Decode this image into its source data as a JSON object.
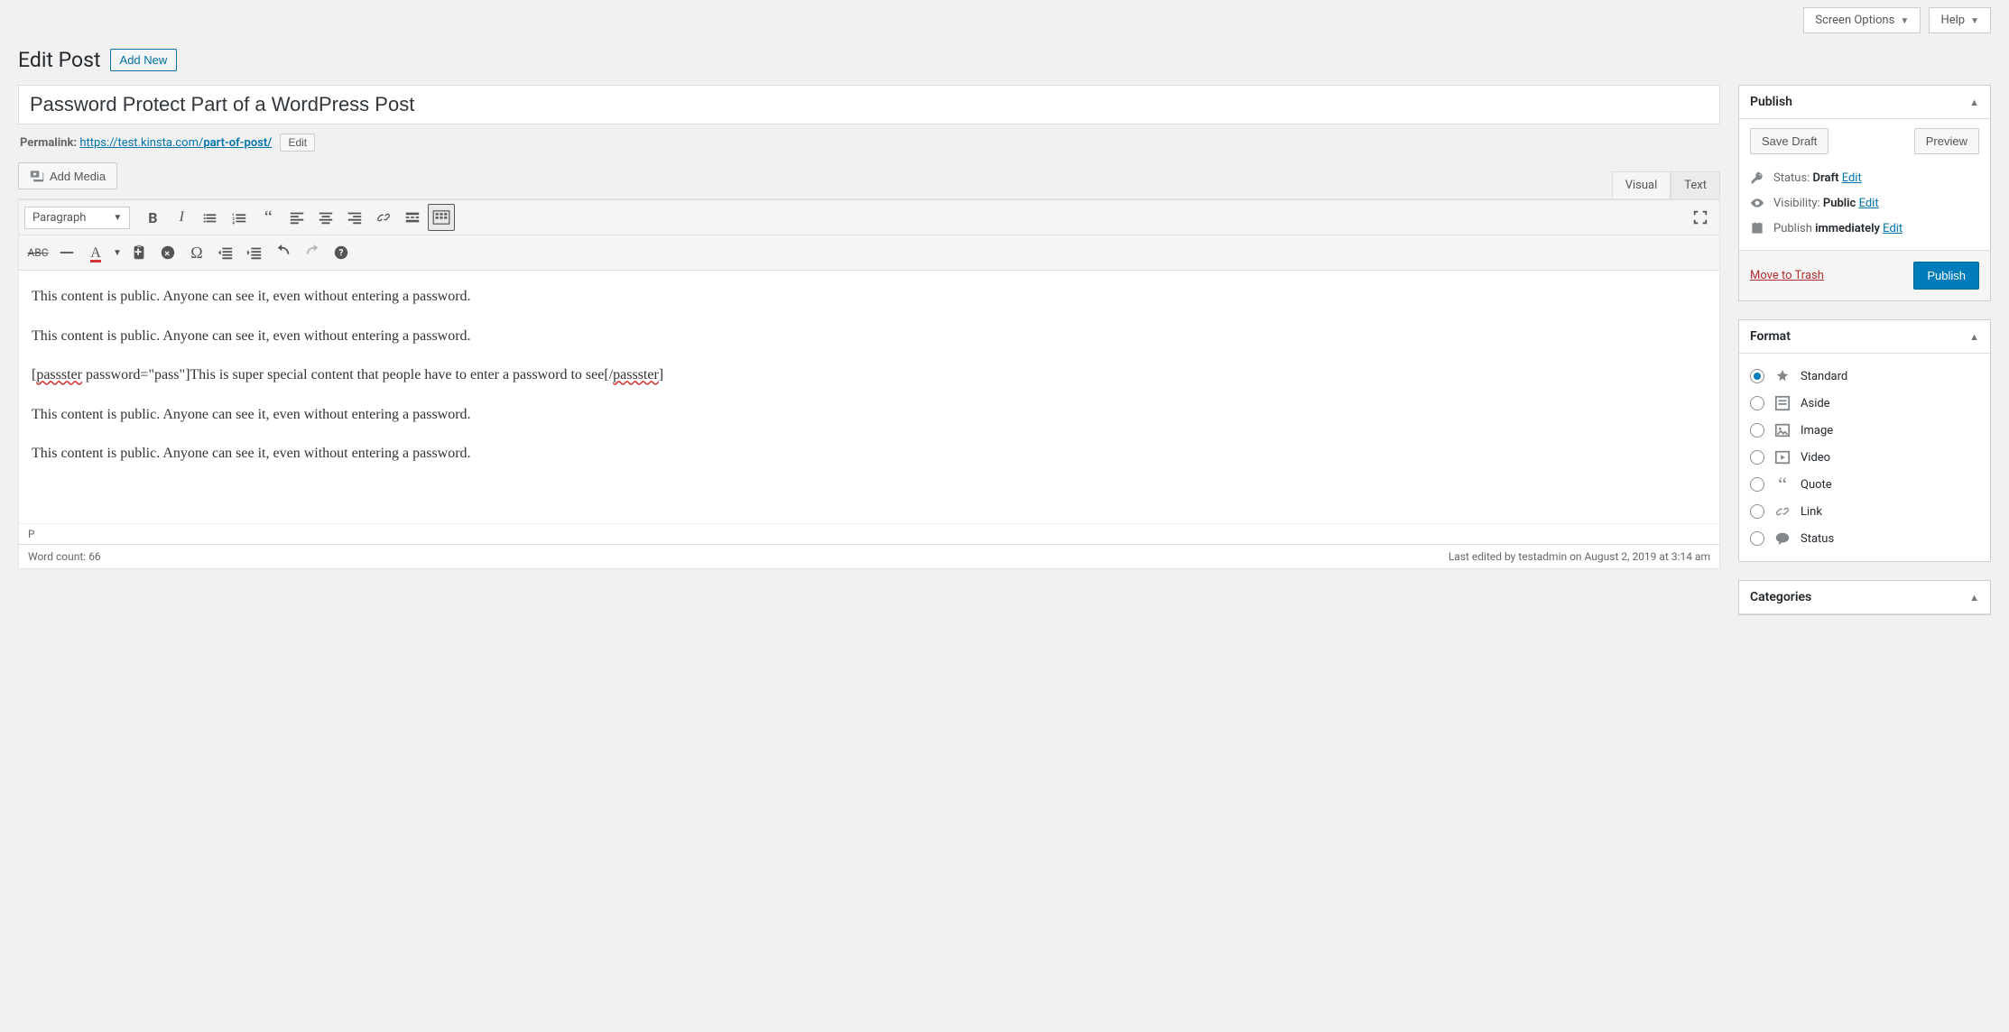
{
  "top": {
    "screen_options": "Screen Options",
    "help": "Help"
  },
  "heading": {
    "title": "Edit Post",
    "add_new": "Add New"
  },
  "post": {
    "title": "Password Protect Part of a WordPress Post",
    "permalink_label": "Permalink:",
    "permalink_base": "https://test.kinsta.com/",
    "permalink_slug": "part-of-post/",
    "edit_btn": "Edit"
  },
  "editor": {
    "add_media": "Add Media",
    "tab_visual": "Visual",
    "tab_text": "Text",
    "format_select": "Paragraph",
    "content": {
      "p1": "This content is public. Anyone can see it, even without entering a password.",
      "p2": "This content is public. Anyone can see it, even without entering a password.",
      "p3_open": "[",
      "p3_tag1": "passster",
      "p3_mid": " password=\"pass\"]This is super special content that people have to enter a password to see[/",
      "p3_tag2": "passster",
      "p3_close": "]",
      "p4": "This content is public. Anyone can see it, even without entering a password.",
      "p5": "This content is public. Anyone can see it, even without entering a password."
    },
    "path": "P",
    "word_count_label": "Word count: ",
    "word_count": "66",
    "last_edited": "Last edited by testadmin on August 2, 2019 at 3:14 am"
  },
  "publish": {
    "title": "Publish",
    "save_draft": "Save Draft",
    "preview": "Preview",
    "status_label": "Status: ",
    "status_value": "Draft",
    "visibility_label": "Visibility: ",
    "visibility_value": "Public",
    "schedule_label": "Publish ",
    "schedule_value": "immediately",
    "edit_link": "Edit",
    "trash": "Move to Trash",
    "publish_btn": "Publish"
  },
  "format": {
    "title": "Format",
    "items": [
      {
        "label": "Standard",
        "checked": true
      },
      {
        "label": "Aside",
        "checked": false
      },
      {
        "label": "Image",
        "checked": false
      },
      {
        "label": "Video",
        "checked": false
      },
      {
        "label": "Quote",
        "checked": false
      },
      {
        "label": "Link",
        "checked": false
      },
      {
        "label": "Status",
        "checked": false
      }
    ]
  },
  "categories": {
    "title": "Categories"
  }
}
